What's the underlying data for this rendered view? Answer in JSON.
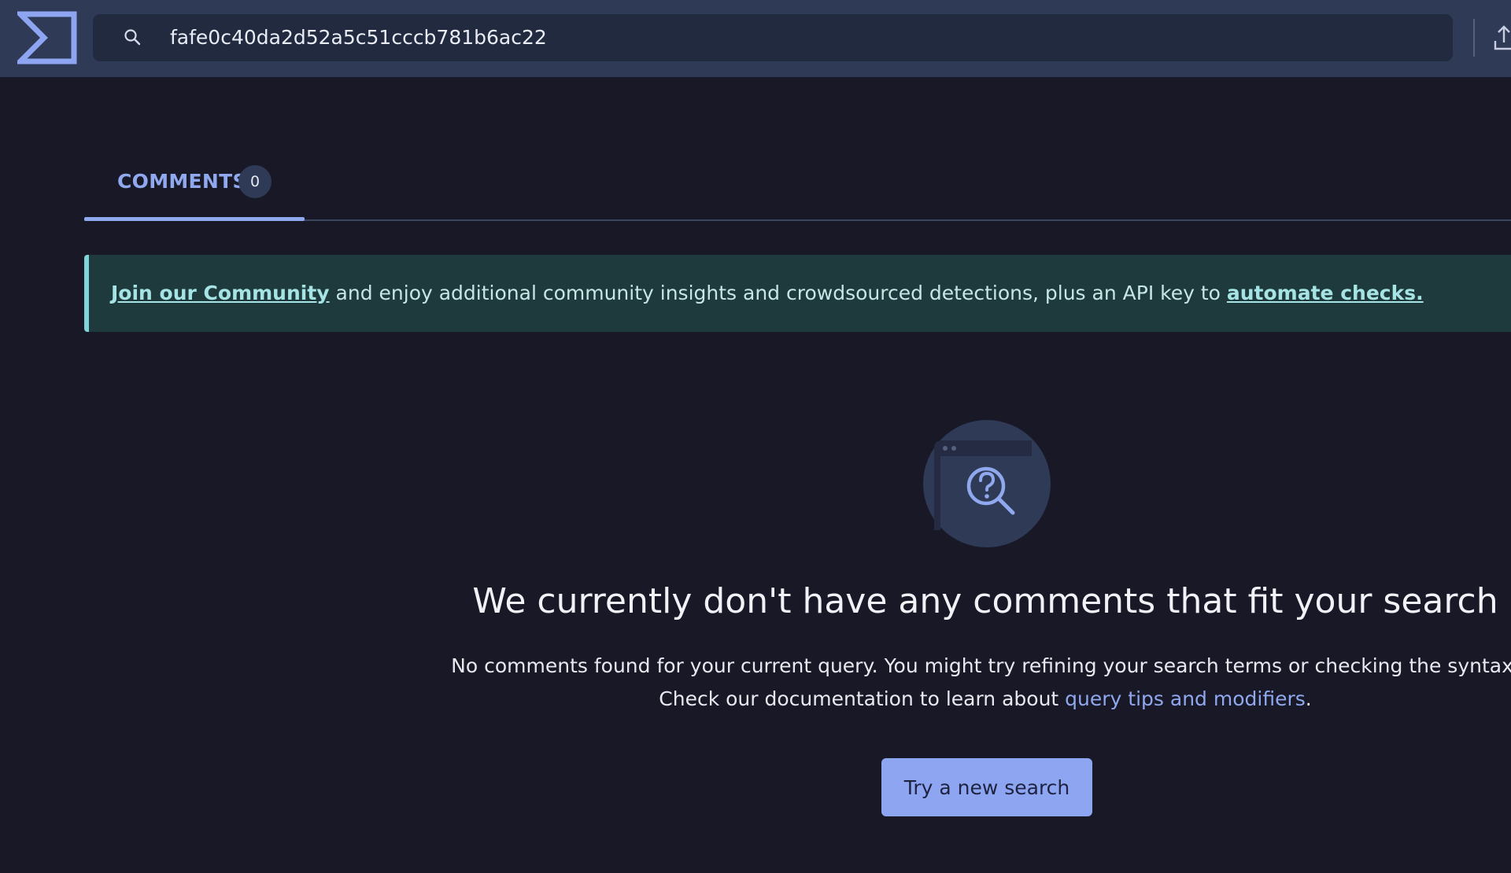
{
  "search": {
    "query": "fafe0c40da2d52a5c51cccb781b6ac22"
  },
  "tabs": [
    {
      "label": "COMMENTS",
      "count": "0"
    }
  ],
  "banner": {
    "join_link": "Join our Community",
    "middle_text": " and enjoy additional community insights and crowdsourced detections, plus an API key to ",
    "automate_link": "automate checks."
  },
  "empty_state": {
    "title": "We currently don't have any comments that fit your search",
    "line1": "No comments found for your current query. You might try refining your search terms or checking the syntax.",
    "line2_prefix": "Check our documentation to learn about ",
    "line2_link": "query tips and modifiers",
    "line2_suffix": ".",
    "button_label": "Try a new search",
    "illustration_icon": "search-question-icon"
  },
  "icons": {
    "logo": "sigma-logo-icon",
    "search": "search-icon",
    "upload": "upload-icon"
  },
  "colors": {
    "topbar": "#2f3a56",
    "background": "#181826",
    "accent": "#8fa8ee",
    "banner_bg": "#1f3a3c",
    "banner_accent": "#7ed4d9"
  }
}
